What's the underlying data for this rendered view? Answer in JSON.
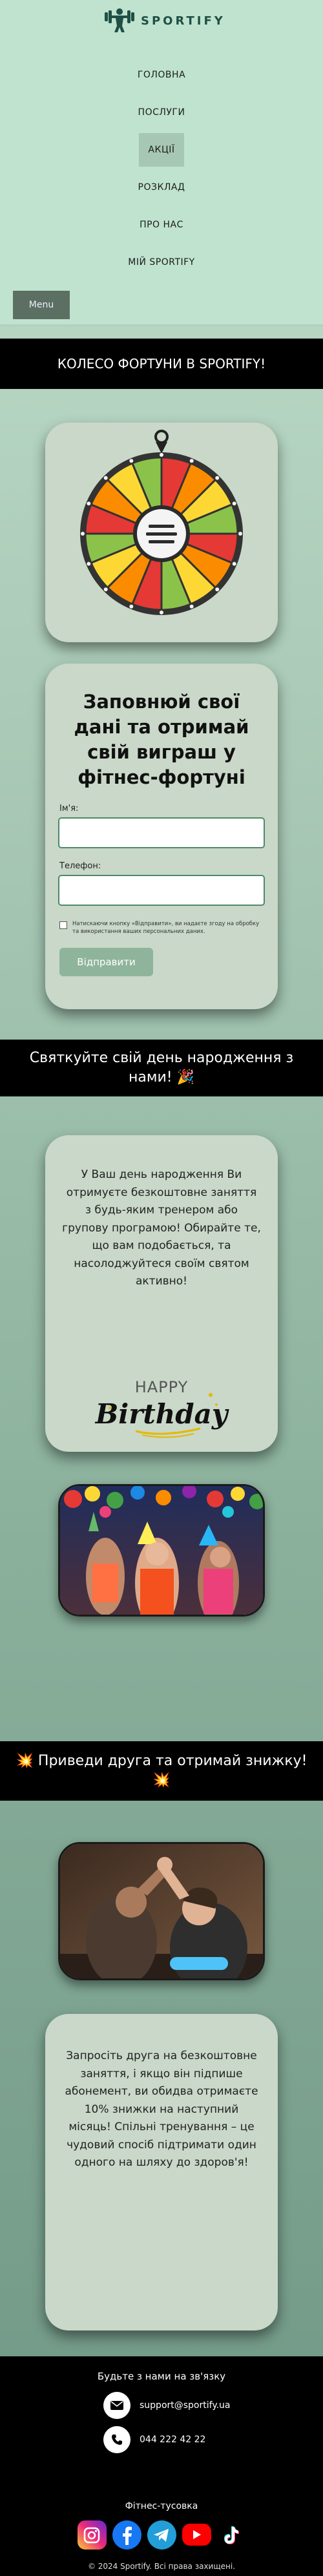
{
  "brand": {
    "name": "SPORTIFY"
  },
  "nav": {
    "items": [
      "ГОЛОВНА",
      "ПОСЛУГИ",
      "АКЦІЇ",
      "РОЗКЛАД",
      "ПРО НАС",
      "МІЙ SPORTIFY"
    ],
    "active_index": 2,
    "menu_label": "Menu"
  },
  "wheel_banner": {
    "title": "КОЛЕСО ФОРТУНИ В SPORTIFY!"
  },
  "form": {
    "title": "Заповнюй свої дані та отримай свій виграш у фітнес-фортуні",
    "name_label": "Ім'я:",
    "name_value": "",
    "phone_label": "Телефон:",
    "phone_value": "",
    "consent_text": "Натискаючи кнопку «Відправити», ви надаєте згоду на обробку та використання ваших персональних даних.",
    "submit_label": "Відправити"
  },
  "birthday": {
    "banner": "Святкуйте свій день народження з нами! 🎉",
    "text": "У Ваш день народження Ви отримуєте безкоштовне заняття з будь-яким тренером або групову програмою! Обирайте те, що вам подобається, та насолоджуйтеся своїм святом активно!",
    "graphic_small": "HAPPY",
    "graphic_large": "Birthday"
  },
  "referral": {
    "banner": "💥 Приведи друга та отримай знижку! 💥",
    "text": "Запросіть друга на безкоштовне заняття, і якщо він підпише абонемент, ви обидва отримаєте 10% знижки на наступний місяць! Спільні тренування – це чудовий спосіб підтримати один одного на шляху до здоров'я!"
  },
  "footer": {
    "contact_title": "Будьте з нами на зв'язку",
    "email": "support@sportify.ua",
    "phone": "044 222 42 22",
    "social_title": "Фітнес-тусовка",
    "socials": [
      "instagram-icon",
      "facebook-icon",
      "telegram-icon",
      "youtube-icon",
      "tiktok-icon"
    ],
    "copyright": "© 2024 Sportify. Всі права захищені."
  },
  "colors": {
    "header_bg": "#bfe3cf",
    "card_bg": "#c9d8c8",
    "banner_bg": "#000000",
    "accent_green": "#8fb49c",
    "input_border": "#4e8a66"
  }
}
